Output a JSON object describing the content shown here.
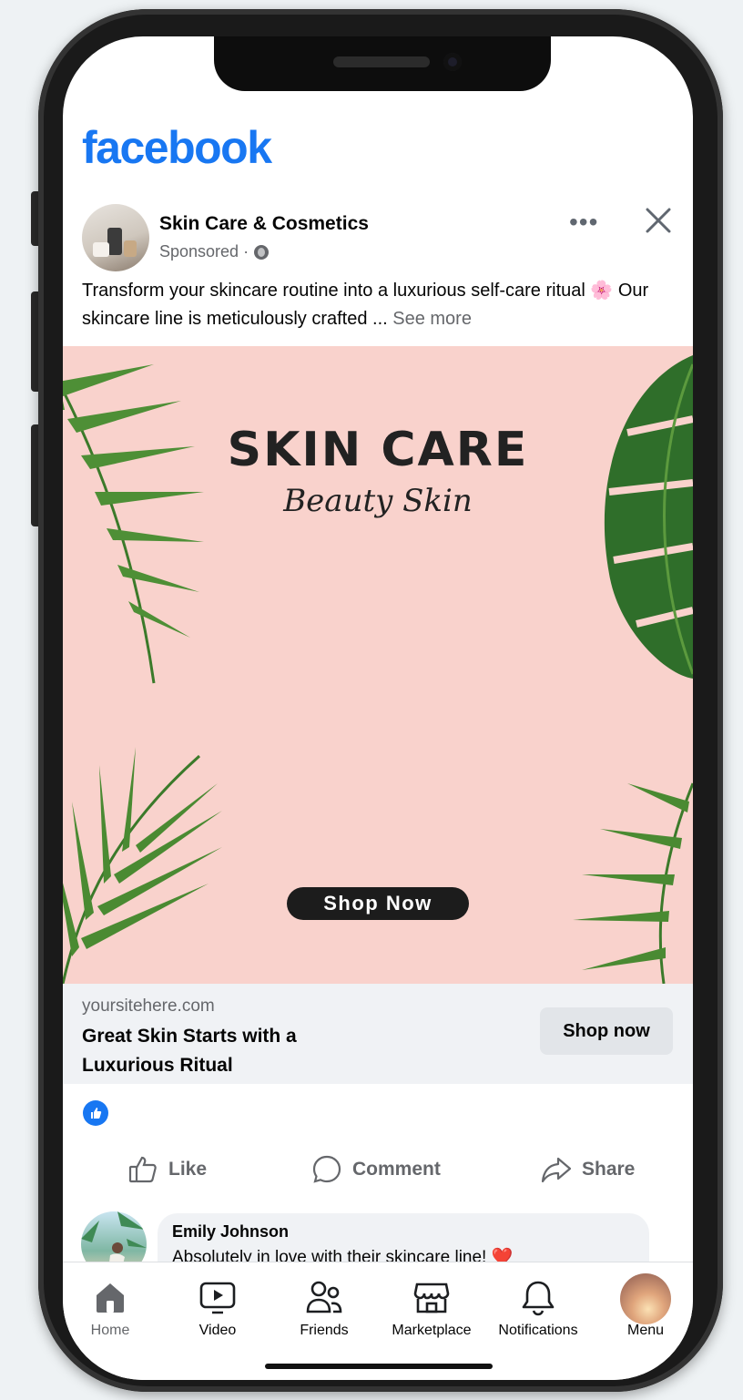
{
  "app": {
    "logo": "facebook"
  },
  "post": {
    "page_name": "Skin Care & Cosmetics",
    "sponsored_label": "Sponsored · ",
    "text_main": "Transform your skincare routine into a luxurious self-care ritual ",
    "text_flower": "🌸",
    "text_rest": " Our skincare line is meticulously crafted ... ",
    "see_more": "See more"
  },
  "ad": {
    "headline": "SKIN CARE",
    "script": "Beauty Skin",
    "pill": "Shop Now",
    "domain": "yoursitehere.com",
    "title": "Great Skin Starts with a Luxurious Ritual",
    "cta": "Shop now"
  },
  "actions": {
    "like": "Like",
    "comment": "Comment",
    "share": "Share"
  },
  "comment": {
    "author": "Emily Johnson",
    "text": "Absolutely in love with their skincare line! ",
    "emoji": "❤️"
  },
  "tabs": [
    {
      "label": "Home",
      "icon": "home-icon"
    },
    {
      "label": "Video",
      "icon": "video-icon"
    },
    {
      "label": "Friends",
      "icon": "friends-icon"
    },
    {
      "label": "Marketplace",
      "icon": "marketplace-icon"
    },
    {
      "label": "Notifications",
      "icon": "bell-icon"
    },
    {
      "label": "Menu",
      "icon": "profile-avatar"
    }
  ],
  "colors": {
    "brand": "#1877f2",
    "ad_background": "#f9d2cc",
    "secondary_text": "#65676b"
  }
}
